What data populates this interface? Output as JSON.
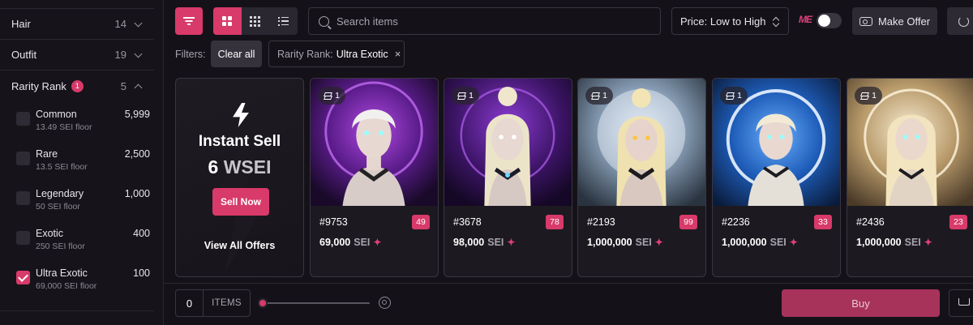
{
  "sidebar": {
    "hair": {
      "label": "Hair",
      "count": "14"
    },
    "outfit": {
      "label": "Outfit",
      "count": "19"
    },
    "rarity": {
      "label": "Rarity Rank",
      "badge": "1",
      "count": "5"
    },
    "rarity_items": [
      {
        "name": "Common",
        "floor": "13.49 SEI floor",
        "count": "5,999",
        "checked": false
      },
      {
        "name": "Rare",
        "floor": "13.5 SEI floor",
        "count": "2,500",
        "checked": false
      },
      {
        "name": "Legendary",
        "floor": "50 SEI floor",
        "count": "1,000",
        "checked": false
      },
      {
        "name": "Exotic",
        "floor": "250 SEI floor",
        "count": "400",
        "checked": false
      },
      {
        "name": "Ultra Exotic",
        "floor": "69,000 SEI floor",
        "count": "100",
        "checked": true
      }
    ]
  },
  "toolbar": {
    "search_placeholder": "Search items",
    "sort_label": "Price: Low to High",
    "me_logo": "ME",
    "make_offer_label": "Make Offer"
  },
  "filters": {
    "label": "Filters:",
    "clear_all": "Clear all",
    "chip_key": "Rarity Rank:",
    "chip_value": "Ultra Exotic",
    "chip_close": "×"
  },
  "instant_sell": {
    "title": "Instant Sell",
    "amount": "6",
    "currency": "WSEI",
    "button": "Sell Now",
    "view_all": "View All Offers"
  },
  "cards": [
    {
      "name": "#9753",
      "rank": "49",
      "price": "69,000",
      "unit": "SEI",
      "edition": "1",
      "theme": "purple"
    },
    {
      "name": "#3678",
      "rank": "78",
      "price": "98,000",
      "unit": "SEI",
      "edition": "1",
      "theme": "violet"
    },
    {
      "name": "#2193",
      "rank": "99",
      "price": "1,000,000",
      "unit": "SEI",
      "edition": "1",
      "theme": "moon"
    },
    {
      "name": "#2236",
      "rank": "33",
      "price": "1,000,000",
      "unit": "SEI",
      "edition": "1",
      "theme": "blue"
    },
    {
      "name": "#2436",
      "rank": "23",
      "price": "1,000,000",
      "unit": "SEI",
      "edition": "1",
      "theme": "gold"
    }
  ],
  "bottom": {
    "qty_value": "0",
    "qty_unit": "ITEMS",
    "buy_label": "Buy"
  },
  "colors": {
    "accent": "#d83a6a",
    "background": "#141218",
    "card": "#1c1a20"
  }
}
